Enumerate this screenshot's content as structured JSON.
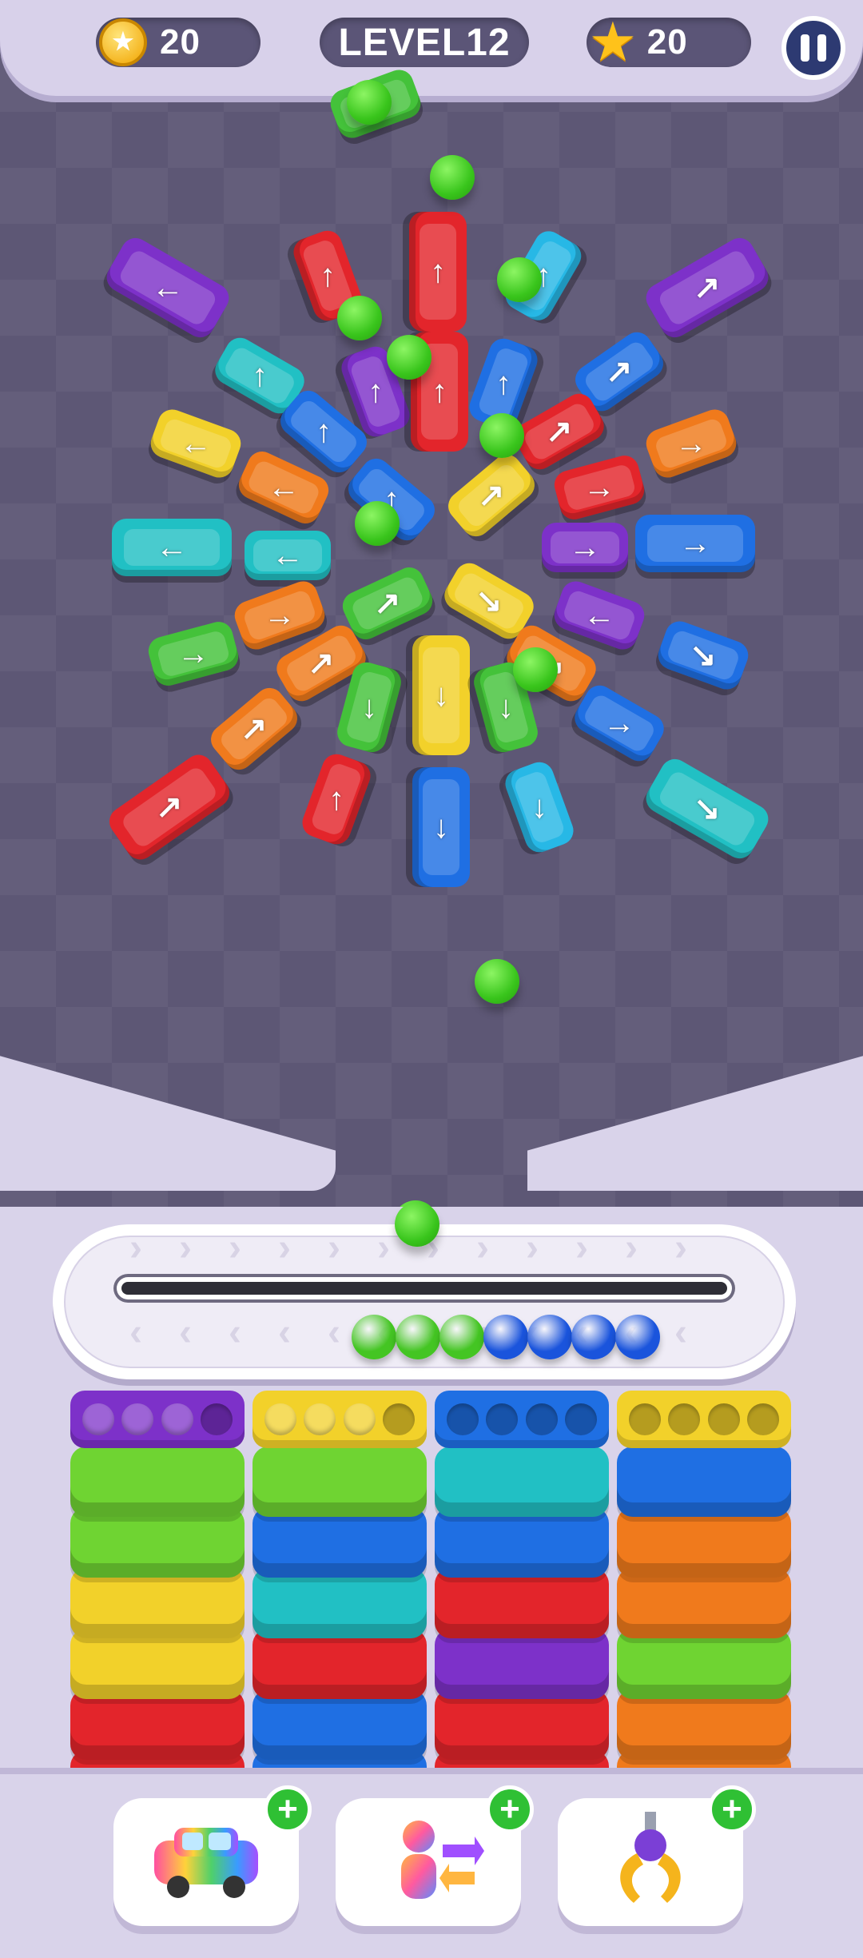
{
  "hud": {
    "coins": "20",
    "level": "LEVEL12",
    "stars": "20",
    "coin_icon": "coin-icon",
    "star_icon": "star-icon",
    "pause_icon": "pause-icon"
  },
  "colors": {
    "red": "#e3252b",
    "blue": "#1f6fe3",
    "green": "#44c23a",
    "yellow": "#f2d12a",
    "purple": "#7d31c9",
    "teal": "#21c0c4",
    "cyan": "#27b8e6",
    "orange": "#f07a1c",
    "ball_green": "#44c523",
    "ball_blue": "#1a54dc",
    "lime": "#6fd432"
  },
  "cars": [
    {
      "color": "green",
      "arrow": "→",
      "kind": "car"
    },
    {
      "color": "purple",
      "arrow": "←",
      "kind": "bus"
    },
    {
      "color": "red",
      "arrow": "↑",
      "kind": "bus"
    },
    {
      "color": "red",
      "arrow": "↑",
      "kind": "car"
    },
    {
      "color": "cyan",
      "arrow": "↑",
      "kind": "car"
    },
    {
      "color": "purple",
      "arrow": "↗",
      "kind": "bus"
    },
    {
      "color": "teal",
      "arrow": "↑",
      "kind": "car"
    },
    {
      "color": "purple",
      "arrow": "↑",
      "kind": "car"
    },
    {
      "color": "red",
      "arrow": "↑",
      "kind": "bus"
    },
    {
      "color": "blue",
      "arrow": "↑",
      "kind": "car"
    },
    {
      "color": "blue",
      "arrow": "↗",
      "kind": "car"
    },
    {
      "color": "yellow",
      "arrow": "←",
      "kind": "car"
    },
    {
      "color": "blue",
      "arrow": "↑",
      "kind": "car"
    },
    {
      "color": "red",
      "arrow": "↗",
      "kind": "car"
    },
    {
      "color": "orange",
      "arrow": "→",
      "kind": "car"
    },
    {
      "color": "orange",
      "arrow": "←",
      "kind": "car"
    },
    {
      "color": "blue",
      "arrow": "↑",
      "kind": "car"
    },
    {
      "color": "yellow",
      "arrow": "↗",
      "kind": "car"
    },
    {
      "color": "red",
      "arrow": "→",
      "kind": "car"
    },
    {
      "color": "teal",
      "arrow": "←",
      "kind": "bus"
    },
    {
      "color": "teal",
      "arrow": "←",
      "kind": "car"
    },
    {
      "color": "purple",
      "arrow": "→",
      "kind": "car"
    },
    {
      "color": "blue",
      "arrow": "→",
      "kind": "bus"
    },
    {
      "color": "orange",
      "arrow": "→",
      "kind": "car"
    },
    {
      "color": "green",
      "arrow": "↗",
      "kind": "car"
    },
    {
      "color": "yellow",
      "arrow": "↘",
      "kind": "car"
    },
    {
      "color": "purple",
      "arrow": "←",
      "kind": "car"
    },
    {
      "color": "green",
      "arrow": "→",
      "kind": "car"
    },
    {
      "color": "orange",
      "arrow": "↗",
      "kind": "car"
    },
    {
      "color": "yellow",
      "arrow": "↓",
      "kind": "bus"
    },
    {
      "color": "green",
      "arrow": "↓",
      "kind": "car"
    },
    {
      "color": "orange",
      "arrow": "↘",
      "kind": "car"
    },
    {
      "color": "blue",
      "arrow": "→",
      "kind": "car"
    },
    {
      "color": "orange",
      "arrow": "↗",
      "kind": "car"
    },
    {
      "color": "green",
      "arrow": "↓",
      "kind": "car"
    },
    {
      "color": "blue",
      "arrow": "↘",
      "kind": "car"
    },
    {
      "color": "red",
      "arrow": "↗",
      "kind": "bus"
    },
    {
      "color": "red",
      "arrow": "↑",
      "kind": "car"
    },
    {
      "color": "blue",
      "arrow": "↓",
      "kind": "bus"
    },
    {
      "color": "cyan",
      "arrow": "↓",
      "kind": "car"
    },
    {
      "color": "teal",
      "arrow": "↘",
      "kind": "bus"
    }
  ],
  "field_balls": 10,
  "belt_balls": [
    "green",
    "green",
    "green",
    "blue",
    "blue",
    "blue",
    "blue"
  ],
  "stacks": [
    {
      "cap": "purple",
      "filled": 3,
      "slabs": [
        "lime",
        "lime",
        "yellow",
        "yellow",
        "red",
        "red"
      ]
    },
    {
      "cap": "yellow",
      "filled": 3,
      "slabs": [
        "lime",
        "blue",
        "teal",
        "red",
        "blue",
        "blue"
      ]
    },
    {
      "cap": "blue",
      "filled": 0,
      "slabs": [
        "teal",
        "blue",
        "red",
        "purple",
        "red",
        "red"
      ]
    },
    {
      "cap": "yellow",
      "filled": 0,
      "slabs": [
        "blue",
        "orange",
        "orange",
        "lime",
        "orange",
        "orange"
      ]
    }
  ],
  "boosters": [
    {
      "name": "rainbow-car-booster",
      "icon": "rainbow-car-icon"
    },
    {
      "name": "swap-booster",
      "icon": "swap-person-icon"
    },
    {
      "name": "claw-booster",
      "icon": "claw-icon"
    }
  ],
  "plus_label": "+"
}
